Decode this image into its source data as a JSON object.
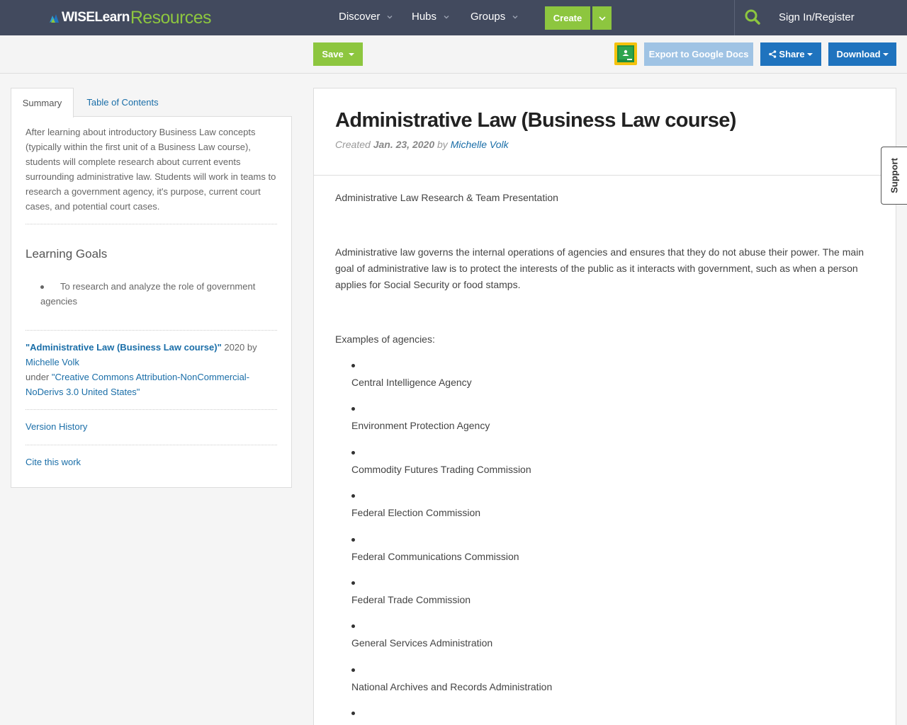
{
  "header": {
    "logo_wise": "WISELearn",
    "logo_resources": "Resources",
    "nav": [
      "Discover",
      "Hubs",
      "Groups"
    ],
    "create_label": "Create",
    "signin_label": "Sign In/Register"
  },
  "toolbar": {
    "save_label": "Save",
    "export_label": "Export to Google Docs",
    "share_label": "Share",
    "download_label": "Download"
  },
  "sidebar": {
    "tabs": [
      "Summary",
      "Table of Contents"
    ],
    "summary": "After learning about introductory Business Law concepts (typically within the first unit of a Business Law course), students will complete research about current events surrounding administrative law. Students will work in teams to research a government agency, it's purpose, current court cases, and potential court cases.",
    "learning_goals_title": "Learning Goals",
    "learning_goals": [
      "To research and analyze the role of government agencies"
    ],
    "attribution": {
      "title": "\"Administrative Law (Business Law course)\"",
      "year_by": " 2020 by ",
      "author": "Michelle Volk",
      "under": "under ",
      "license": "\"Creative Commons Attribution-NonCommercial-NoDerivs 3.0 United States\""
    },
    "version_history": "Version History",
    "cite": "Cite this work"
  },
  "main": {
    "title": "Administrative Law (Business Law course)",
    "created_prefix": "Created ",
    "created_date": "Jan. 23, 2020",
    "by": " by ",
    "author": "Michelle Volk",
    "subtitle": "Administrative Law Research & Team Presentation",
    "intro": "Administrative law governs the internal operations of agencies and ensures that they do not abuse their power. The main goal of administrative law is to protect the interests of the public as it interacts with government, such as when a person applies for Social Security or food stamps.",
    "examples_label": "Examples of agencies:",
    "agencies": [
      "Central Intelligence Agency",
      "Environment Protection Agency",
      "Commodity Futures Trading Commission",
      "Federal Election Commission",
      "Federal Communications Commission",
      "Federal Trade Commission",
      "General Services Administration",
      "National Archives and Records Administration",
      ""
    ]
  },
  "support_label": "Support",
  "colors": {
    "nav_bg": "#424a5e",
    "green": "#8dc63f",
    "blue": "#1f73be",
    "light_blue": "#9fc3e4",
    "link": "#1a6ea8"
  },
  "icons": [
    "wiselearn-logo-icon",
    "chevron-down-icon",
    "search-icon",
    "google-classroom-icon",
    "share-icon",
    "caret-down-icon"
  ]
}
